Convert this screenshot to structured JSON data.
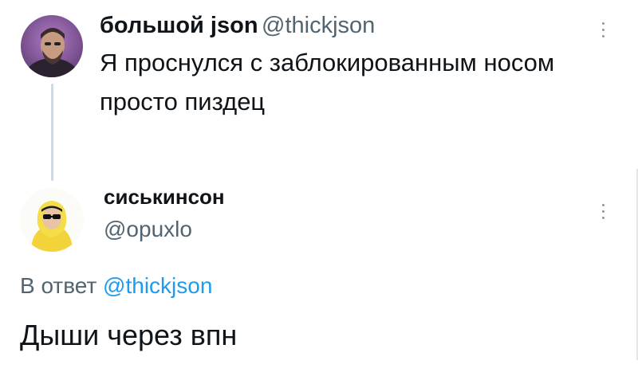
{
  "tweet": {
    "author_name": "большой json",
    "author_handle": "@thickjson",
    "text_line1": "Я проснулся с заблокированным носом",
    "text_line2": "просто пиздец"
  },
  "reply": {
    "author_name": "сиськинсон",
    "author_handle": "@opuxlo",
    "reply_to_prefix": "В ответ",
    "reply_to_handle": "@thickjson",
    "text": "Дыши через впн"
  },
  "icons": {
    "more": "more-vertical-icon"
  },
  "colors": {
    "text": "#0f1419",
    "secondary": "#536471",
    "link": "#1d9bf0",
    "thread_line": "#cfd9de"
  }
}
